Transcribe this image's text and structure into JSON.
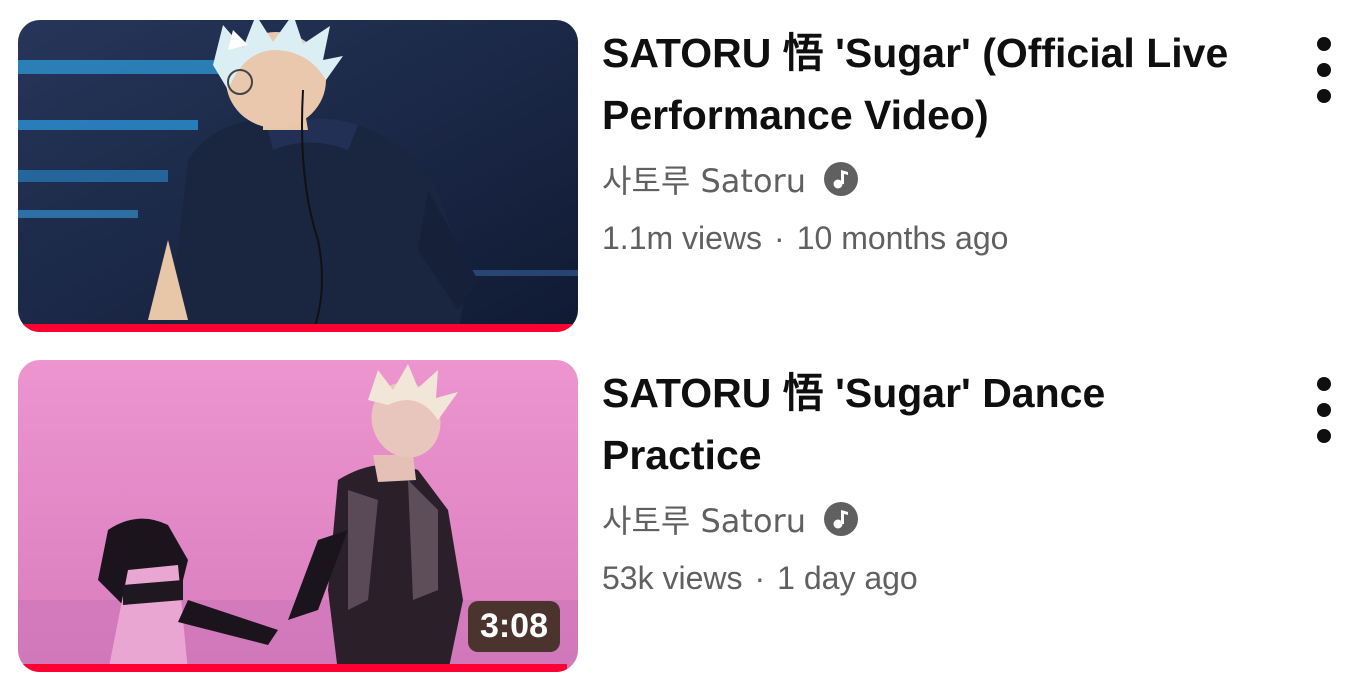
{
  "videos": [
    {
      "title": "SATORU 悟 'Sugar' (Official Live Performance Video)",
      "channel": "사토루 Satoru",
      "channel_badge_icon": "music-note-icon",
      "views": "1.1m views",
      "separator": "·",
      "age": "10 months ago",
      "duration": "",
      "watched_fraction": 1.0,
      "more_icon": "vertical-ellipsis-icon"
    },
    {
      "title": "SATORU 悟 'Sugar' Dance Practice",
      "channel": "사토루 Satoru",
      "channel_badge_icon": "music-note-icon",
      "views": "53k views",
      "separator": "·",
      "age": "1 day ago",
      "duration": "3:08",
      "watched_fraction": 0.98,
      "more_icon": "vertical-ellipsis-icon"
    }
  ],
  "colors": {
    "progress": "#ff0033",
    "title": "#0f0f0f",
    "meta": "#606060",
    "thumb1_bg": "#1b2b4b",
    "thumb2_bg": "#e58bc5",
    "duration_bg": "#4a3c1c"
  }
}
